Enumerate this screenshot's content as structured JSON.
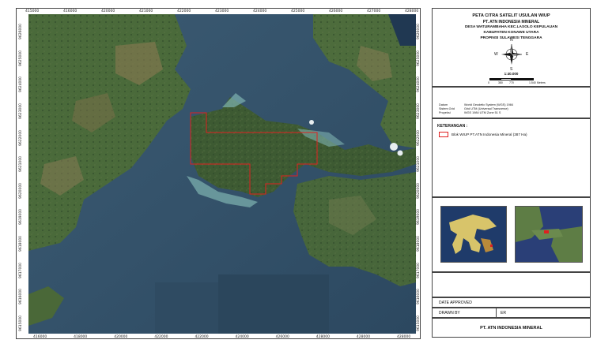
{
  "title": {
    "line1": "PETA CITRA SATELIT USULAN WIUP",
    "line2": "PT. ATN INDONESIA MINERAL",
    "line3": "DESA WATURAMBAHA KEC.LASOLO KEPULAUAN",
    "line4": "KABUPATEN KONAWE UTARA",
    "line5": "PROPINSI SULAWESI TENGGARA"
  },
  "compass": {
    "north": "N",
    "south": "S",
    "east": "E",
    "west": "W"
  },
  "scale": {
    "ratio": "1:40.000",
    "labels": [
      "0",
      "380",
      "770",
      "1.540"
    ],
    "unit": "Meters"
  },
  "metadata": [
    {
      "key": "Datum",
      "value": "World Geodetic System (WGS) 1984"
    },
    {
      "key": "Sistem Grid",
      "value": "Grid UTM (Universal Transverse)"
    },
    {
      "key": "Proyeksi",
      "value": "WGS 1984 UTM Zone 51 S"
    }
  ],
  "legend": {
    "heading": "KETERANGAN :",
    "item_label": "Blok WIUP PT.ATN Indonesia Mineral (387 Ha)",
    "item_color": "#e02020"
  },
  "footer": {
    "date_label": "DATE APPROVED",
    "drawn_label": "DRAWN BY",
    "drawn_value": "ER",
    "company": "PT. ATN INDONESIA MINERAL"
  },
  "axis": {
    "top": [
      "415000",
      "416000",
      "420000",
      "421000",
      "422000",
      "423000",
      "424000",
      "425000",
      "426000",
      "427000",
      "428000"
    ],
    "bottom": [
      "416000",
      "418000",
      "420000",
      "422000",
      "422000",
      "424000",
      "426000",
      "428000",
      "428000",
      "428000"
    ],
    "left": [
      "9626000",
      "9625000",
      "9624000",
      "9623000",
      "9622000",
      "9621000",
      "9620000",
      "9619000",
      "9618000",
      "9617000",
      "9616000",
      "9615000"
    ],
    "right": [
      "9626000",
      "9625000",
      "9624000",
      "9623000",
      "9622000",
      "9621000",
      "9620000",
      "9619000",
      "9618000",
      "9617000",
      "9616000",
      "9615000"
    ]
  },
  "colors": {
    "sea_deep": "#2f4c66",
    "sea_mid": "#3d5f78",
    "land_green": "#3f5a35",
    "land_dark": "#2d4427",
    "reef": "#6fa6a6",
    "boundary": "#e02020"
  }
}
